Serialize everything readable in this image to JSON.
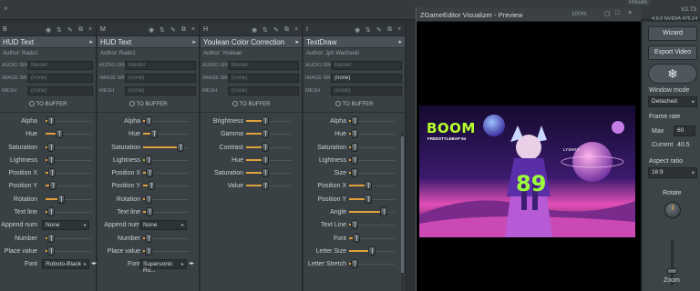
{
  "top": {
    "presets_label": "Presets",
    "version": "V2.73",
    "close": "×"
  },
  "panels": [
    {
      "id": "B",
      "title": "HUD Text",
      "author": "Author: Rado1",
      "audio_src": "Master",
      "image_src": "(none)",
      "mesh": "(none)",
      "image_src_active": false,
      "to_buffer": "TO BUFFER",
      "params": [
        {
          "label": "Alpha",
          "type": "slider",
          "value": 0.04
        },
        {
          "label": "Hue",
          "type": "slider",
          "value": 0.25
        },
        {
          "label": "Saturation",
          "type": "slider",
          "value": 0.04
        },
        {
          "label": "Lightness",
          "type": "slider",
          "value": 0.04
        },
        {
          "label": "Position X",
          "type": "slider",
          "value": 0.08
        },
        {
          "label": "Position Y",
          "type": "slider",
          "value": 0.1
        },
        {
          "label": "Rotation",
          "type": "slider",
          "value": 0.3
        },
        {
          "label": "Text line",
          "type": "slider",
          "value": 0.04
        },
        {
          "label": "Append num",
          "type": "dropdown",
          "value": "None"
        },
        {
          "label": "Number",
          "type": "slider",
          "value": 0.04
        },
        {
          "label": "Place value",
          "type": "slider",
          "value": 0.04
        },
        {
          "label": "Font",
          "type": "dropdown",
          "value": "Roboto-Black",
          "arrows": true
        }
      ]
    },
    {
      "id": "M",
      "title": "HUD Text",
      "author": "Author: Rado1",
      "audio_src": "Master",
      "image_src": "(none)",
      "mesh": "(none)",
      "image_src_active": false,
      "to_buffer": "TO BUFFER",
      "params": [
        {
          "label": "Alpha",
          "type": "slider",
          "value": 0.04
        },
        {
          "label": "Hue",
          "type": "slider",
          "value": 0.2
        },
        {
          "label": "Saturation",
          "type": "slider",
          "value": 0.88
        },
        {
          "label": "Lightness",
          "type": "slider",
          "value": 0.04
        },
        {
          "label": "Position X",
          "type": "slider",
          "value": 0.08
        },
        {
          "label": "Position Y",
          "type": "slider",
          "value": 0.12
        },
        {
          "label": "Rotation",
          "type": "slider",
          "value": 0.04
        },
        {
          "label": "Text line",
          "type": "slider",
          "value": 0.08
        },
        {
          "label": "Append num",
          "type": "dropdown",
          "value": "None"
        },
        {
          "label": "Number",
          "type": "slider",
          "value": 0.04
        },
        {
          "label": "Place value",
          "type": "slider",
          "value": 0.04
        },
        {
          "label": "Font",
          "type": "dropdown",
          "value": "Supersonic Ro...",
          "arrows": true
        }
      ]
    },
    {
      "id": "H",
      "title": "Youlean Color Correction",
      "author": "Author: Youlean",
      "audio_src": "Master",
      "image_src": "(none)",
      "mesh": "(none)",
      "image_src_active": false,
      "to_buffer": "TO BUFFER",
      "params": [
        {
          "label": "Brightness",
          "type": "slider",
          "value": 0.4
        },
        {
          "label": "Gamma",
          "type": "slider",
          "value": 0.4
        },
        {
          "label": "Contrast",
          "type": "slider",
          "value": 0.4
        },
        {
          "label": "Hue",
          "type": "slider",
          "value": 0.4
        },
        {
          "label": "Saturation",
          "type": "slider",
          "value": 0.4
        },
        {
          "label": "Value",
          "type": "slider",
          "value": 0.4
        }
      ]
    },
    {
      "id": "I",
      "title": "TextDraw",
      "author": "Author: Jph Wacheski",
      "audio_src": "Master",
      "image_src": "(none)",
      "mesh": "(none)",
      "image_src_active": true,
      "to_buffer": "TO BUFFER",
      "params": [
        {
          "label": "Alpha",
          "type": "slider",
          "value": 0.04
        },
        {
          "label": "Hue",
          "type": "slider",
          "value": 0.04
        },
        {
          "label": "Saturation",
          "type": "slider",
          "value": 0.04
        },
        {
          "label": "Lightness",
          "type": "slider",
          "value": 0.04
        },
        {
          "label": "Size",
          "type": "slider",
          "value": 0.04
        },
        {
          "label": "Position X",
          "type": "slider",
          "value": 0.4
        },
        {
          "label": "Position Y",
          "type": "slider",
          "value": 0.4
        },
        {
          "label": "Angle",
          "type": "slider",
          "value": 0.8
        },
        {
          "label": "Text Line",
          "type": "slider",
          "value": 0.04
        },
        {
          "label": "Font",
          "type": "slider",
          "value": 0.1
        },
        {
          "label": "Letter Size",
          "type": "slider",
          "value": 0.5
        },
        {
          "label": "Letter Stretch",
          "type": "slider",
          "value": 0.04
        }
      ]
    }
  ],
  "src_labels": {
    "audio": "AUDIO SRC",
    "image": "IMAGE SRC",
    "mesh": "MESH"
  },
  "preview": {
    "title": "ZGameEditor Visualizer - Preview",
    "zoom": "100%",
    "art_text": "BOOM",
    "art_sub": "FREESTYLEBAP 94",
    "art_number": "89",
    "art_tag": "LYSNRY"
  },
  "controls": {
    "version_line": "4.6.0 NVIDIA 475.14",
    "wizard": "Wizard",
    "export_video": "Export Video",
    "window_mode_label": "Window mode",
    "window_mode_value": "Detached",
    "frame_rate_label": "Frame rate",
    "max_label": "Max",
    "max_value": "60",
    "current_label": "Current",
    "current_value": "40.5",
    "aspect_label": "Aspect ratio",
    "aspect_value": "16:9",
    "rotate_label": "Rotate",
    "zoom_label": "Zoom"
  },
  "colors": {
    "accent": "#e0a23b",
    "bg": "#2b3034",
    "panel": "#3a4145"
  }
}
